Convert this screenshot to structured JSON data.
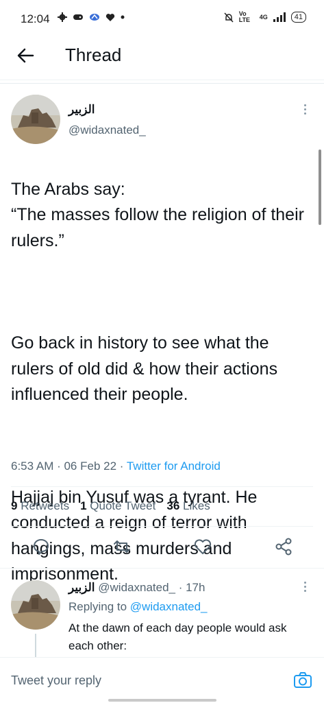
{
  "status_bar": {
    "time": "12:04",
    "volte": "Vo LTE",
    "network": "4G",
    "battery": "41"
  },
  "header": {
    "title": "Thread"
  },
  "tweet": {
    "author_name": "الزبير",
    "author_handle": "@widaxnated_",
    "paragraphs": [
      "The Arabs say:\n “The masses follow the religion of their rulers.”",
      "Go back in history to see what the rulers of old did & how their actions influenced their people.",
      "Hajjaj bin Yusuf was a tyrant. He conducted a reign of terror with hangings, mass murders and imprisonment."
    ],
    "timestamp": "6:53 AM · 06 Feb 22 · ",
    "source": "Twitter for Android",
    "stats": {
      "retweets_count": "9",
      "retweets_label": "Retweets",
      "quotes_count": "1",
      "quotes_label": "Quote Tweet",
      "likes_count": "36",
      "likes_label": "Likes"
    }
  },
  "reply": {
    "author_name": "الزبير",
    "author_handle": "@widaxnated_",
    "time": "· 17h",
    "replying_label": "Replying to ",
    "replying_handle": "@widaxnated_",
    "text": "At the dawn of each day people would ask each other:"
  },
  "composer": {
    "placeholder": "Tweet your reply"
  },
  "colors": {
    "accent": "#1d9bf0",
    "secondary_text": "#536471",
    "primary_text": "#0f1419"
  }
}
